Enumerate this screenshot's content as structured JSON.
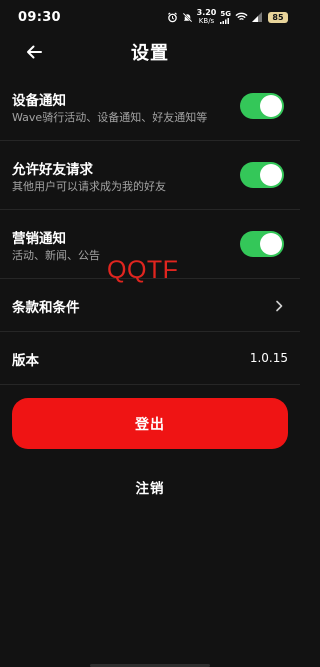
{
  "status_bar": {
    "time": "09:30",
    "net_speed_value": "3.20",
    "net_speed_unit": "KB/s",
    "signal_label": "5G",
    "battery_level": "85",
    "icons": [
      "alarm-icon",
      "mute-icon",
      "wifi-icon",
      "signal-icon",
      "battery-icon"
    ]
  },
  "header": {
    "title": "设置",
    "back_icon": "back-arrow-icon"
  },
  "settings": {
    "device_notification": {
      "title": "设备通知",
      "subtitle": "Wave骑行活动、设备通知、好友通知等",
      "enabled": true
    },
    "friend_requests": {
      "title": "允许好友请求",
      "subtitle": "其他用户可以请求成为我的好友",
      "enabled": true
    },
    "marketing_notification": {
      "title": "营销通知",
      "subtitle": "活动、新闻、公告",
      "enabled": true
    },
    "terms": {
      "title": "条款和条件"
    },
    "version": {
      "title": "版本",
      "value": "1.0.15"
    }
  },
  "watermark": "QQTF",
  "actions": {
    "logout_label": "登出",
    "deregister_label": "注销"
  },
  "colors": {
    "background": "#121212",
    "toggle_on": "#34c759",
    "logout_button": "#ef1414",
    "watermark": "#e0251f"
  }
}
